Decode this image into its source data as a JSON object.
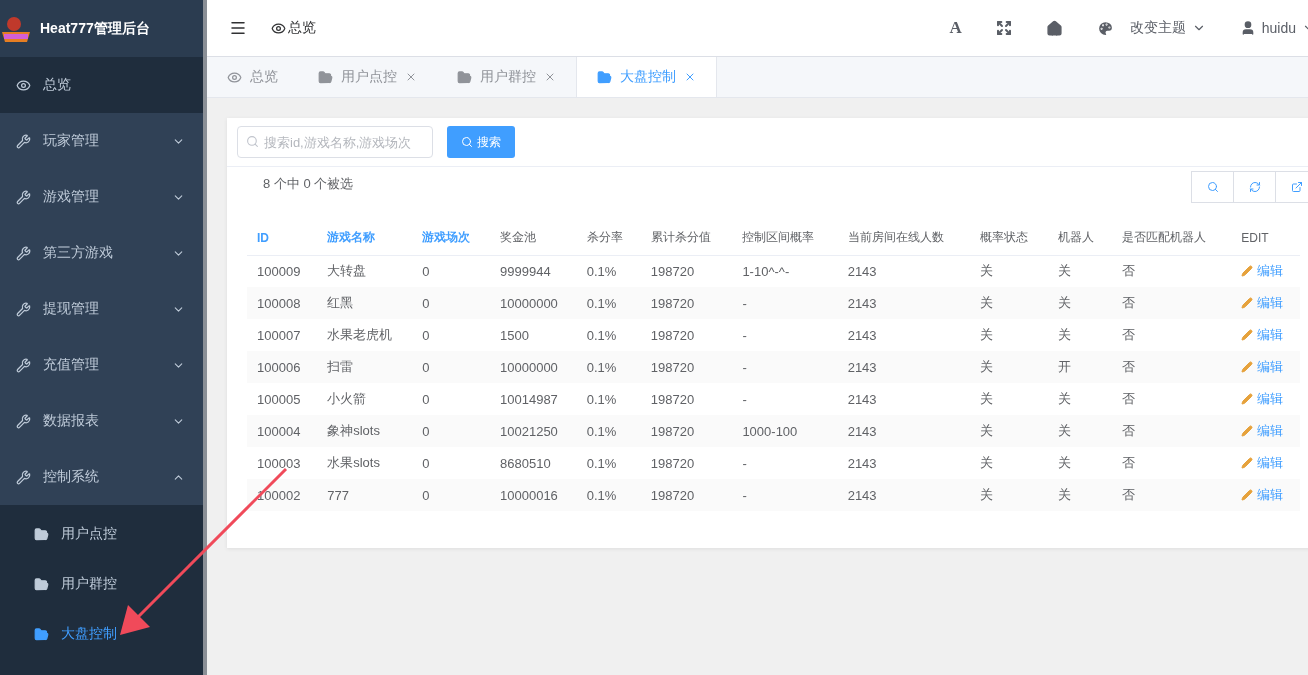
{
  "brand": {
    "title": "Heat777管理后台"
  },
  "sidebar": {
    "items": [
      {
        "kind": "page",
        "label": "总览"
      },
      {
        "kind": "group",
        "label": "玩家管理",
        "expanded": false
      },
      {
        "kind": "group",
        "label": "游戏管理",
        "expanded": false
      },
      {
        "kind": "group",
        "label": "第三方游戏",
        "expanded": false
      },
      {
        "kind": "group",
        "label": "提现管理",
        "expanded": false
      },
      {
        "kind": "group",
        "label": "充值管理",
        "expanded": false
      },
      {
        "kind": "group",
        "label": "数据报表",
        "expanded": false
      },
      {
        "kind": "group",
        "label": "控制系统",
        "expanded": true,
        "children": [
          {
            "label": "用户点控",
            "selected": false
          },
          {
            "label": "用户群控",
            "selected": false
          },
          {
            "label": "大盘控制",
            "selected": true
          }
        ]
      }
    ]
  },
  "topbar": {
    "breadcrumb": "总览",
    "font_button": "A",
    "theme": "改变主题",
    "user": "huidu"
  },
  "tabs": [
    {
      "kind": "home",
      "label": "总览",
      "selected": false
    },
    {
      "kind": "page",
      "label": "用户点控",
      "selected": false
    },
    {
      "kind": "page",
      "label": "用户群控",
      "selected": false
    },
    {
      "kind": "page",
      "label": "大盘控制",
      "selected": true
    }
  ],
  "toolbar": {
    "search": {
      "placeholder": "搜索id,游戏名称,游戏场次"
    },
    "search_button": "搜索",
    "selection": "8 个中 0 个被选"
  },
  "table": {
    "columns": [
      {
        "label": "ID",
        "sortable": true
      },
      {
        "label": "游戏名称",
        "sortable": true
      },
      {
        "label": "游戏场次",
        "sortable": true
      },
      {
        "label": "奖金池",
        "sortable": false
      },
      {
        "label": "杀分率",
        "sortable": false
      },
      {
        "label": "累计杀分值",
        "sortable": false
      },
      {
        "label": "控制区间概率",
        "sortable": false
      },
      {
        "label": "当前房间在线人数",
        "sortable": false
      },
      {
        "label": "概率状态",
        "sortable": false
      },
      {
        "label": "机器人",
        "sortable": false
      },
      {
        "label": "是否匹配机器人",
        "sortable": false
      },
      {
        "label": "EDIT",
        "sortable": false
      }
    ],
    "rows": [
      [
        "100009",
        "大转盘",
        "0",
        "9999944",
        "0.1%",
        "198720",
        "1-10^-^-",
        "2143",
        "关",
        "关",
        "否",
        "编辑"
      ],
      [
        "100008",
        "红黑",
        "0",
        "10000000",
        "0.1%",
        "198720",
        "-",
        "2143",
        "关",
        "关",
        "否",
        "编辑"
      ],
      [
        "100007",
        "水果老虎机",
        "0",
        "1500",
        "0.1%",
        "198720",
        "-",
        "2143",
        "关",
        "关",
        "否",
        "编辑"
      ],
      [
        "100006",
        "扫雷",
        "0",
        "10000000",
        "0.1%",
        "198720",
        "-",
        "2143",
        "关",
        "开",
        "否",
        "编辑"
      ],
      [
        "100005",
        "小火箭",
        "0",
        "10014987",
        "0.1%",
        "198720",
        "-",
        "2143",
        "关",
        "关",
        "否",
        "编辑"
      ],
      [
        "100004",
        "象神slots",
        "0",
        "10021250",
        "0.1%",
        "198720",
        "1000-100",
        "2143",
        "关",
        "关",
        "否",
        "编辑"
      ],
      [
        "100003",
        "水果slots",
        "0",
        "8680510",
        "0.1%",
        "198720",
        "-",
        "2143",
        "关",
        "关",
        "否",
        "编辑"
      ],
      [
        "100002",
        "777",
        "0",
        "10000016",
        "0.1%",
        "198720",
        "-",
        "2143",
        "关",
        "关",
        "否",
        "编辑"
      ]
    ]
  }
}
